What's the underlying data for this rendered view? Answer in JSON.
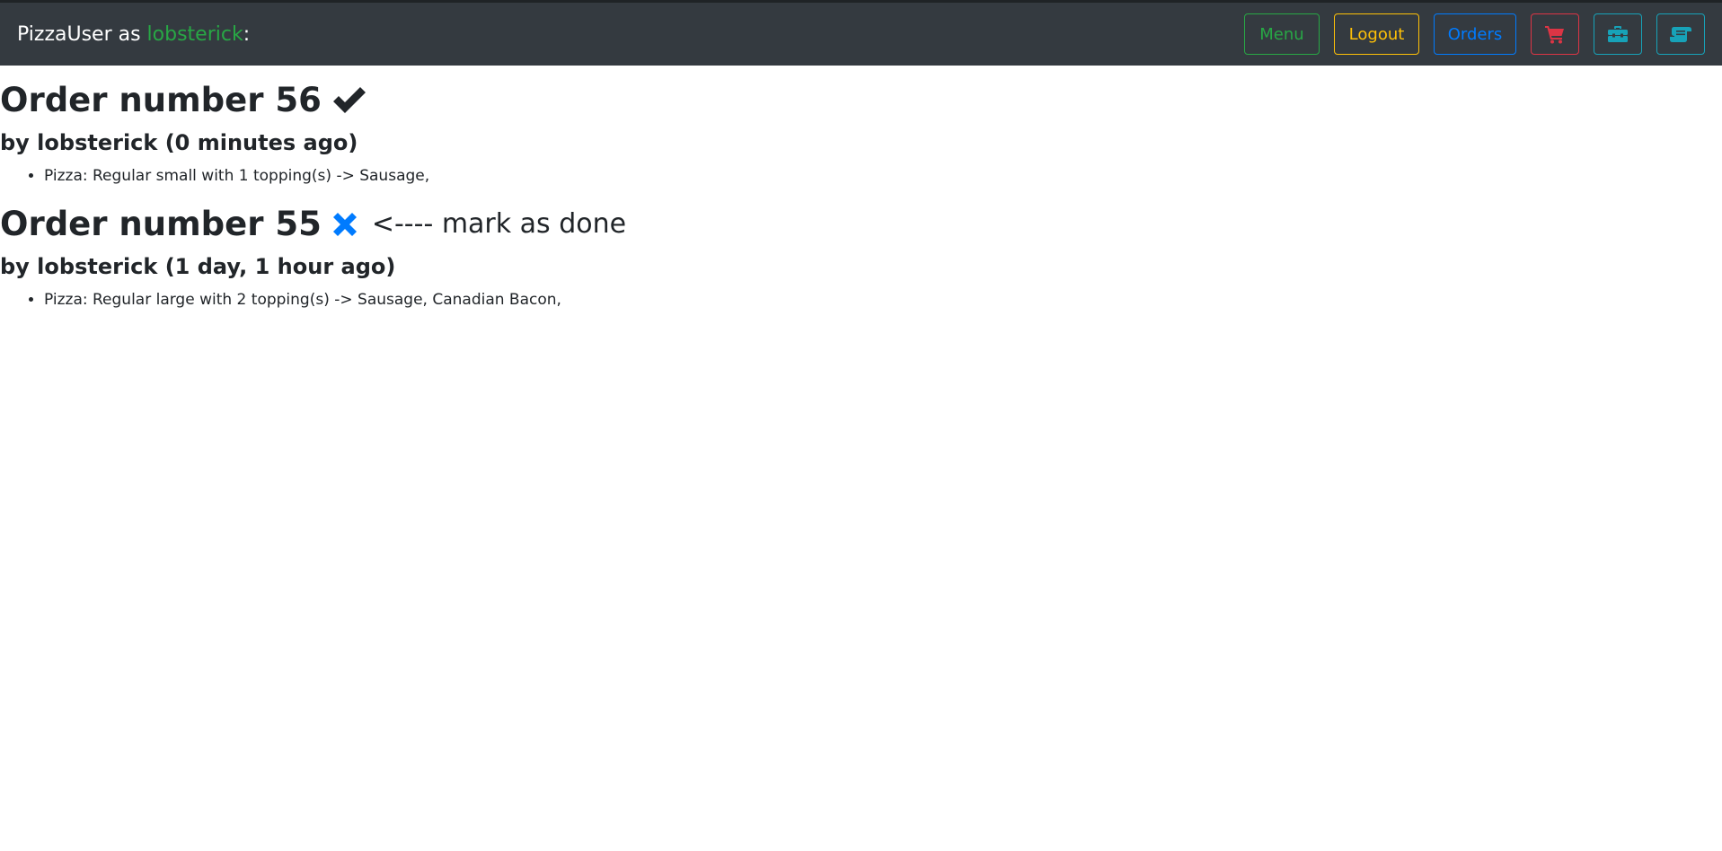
{
  "navbar": {
    "brand_prefix": "PizzaUser as ",
    "username": "lobsterick",
    "brand_suffix": ":",
    "buttons": {
      "menu": "Menu",
      "logout": "Logout",
      "orders": "Orders"
    },
    "icons": {
      "cart": "cart-icon",
      "toolbox": "toolbox-icon",
      "scroll": "scroll-icon"
    }
  },
  "orders": [
    {
      "title": "Order number 56",
      "status": "done",
      "status_icon": "check-icon",
      "byline": "by lobsterick (0 minutes ago)",
      "items": [
        "Pizza: Regular small with 1 topping(s) -> Sausage,"
      ]
    },
    {
      "title": "Order number 55",
      "status": "not-done",
      "status_icon": "x-icon",
      "mark_done_label": "<---- mark as done",
      "byline": "by lobsterick (1 day, 1 hour ago)",
      "items": [
        "Pizza: Regular large with 2 topping(s) -> Sausage, Canadian Bacon,"
      ]
    }
  ],
  "colors": {
    "navbar_bg": "#343a40",
    "success": "#28a745",
    "warning": "#ffc107",
    "primary": "#007bff",
    "danger": "#dc3545",
    "info": "#17a2b8"
  }
}
